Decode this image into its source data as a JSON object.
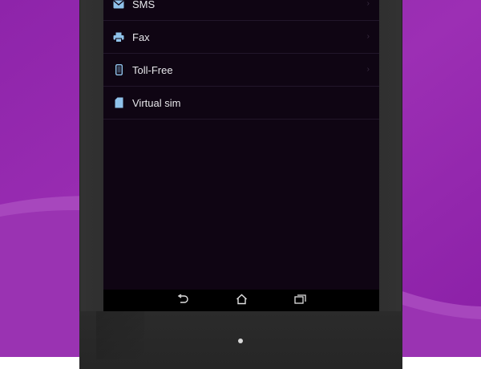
{
  "list": {
    "items": [
      {
        "label": "SMS",
        "icon": "envelope-icon"
      },
      {
        "label": "Fax",
        "icon": "printer-icon"
      },
      {
        "label": "Toll-Free",
        "icon": "phone-device-icon"
      },
      {
        "label": "Virtual sim",
        "icon": "sim-card-icon"
      }
    ]
  },
  "navbar": {
    "buttons": [
      {
        "icon": "back-icon"
      },
      {
        "icon": "home-icon"
      },
      {
        "icon": "recent-apps-icon"
      }
    ]
  },
  "colors": {
    "background_purple": "#9a2bb0",
    "screen_bg": "#0f0513",
    "icon_blue": "#8fc2ea",
    "text": "#e6e6ea"
  }
}
